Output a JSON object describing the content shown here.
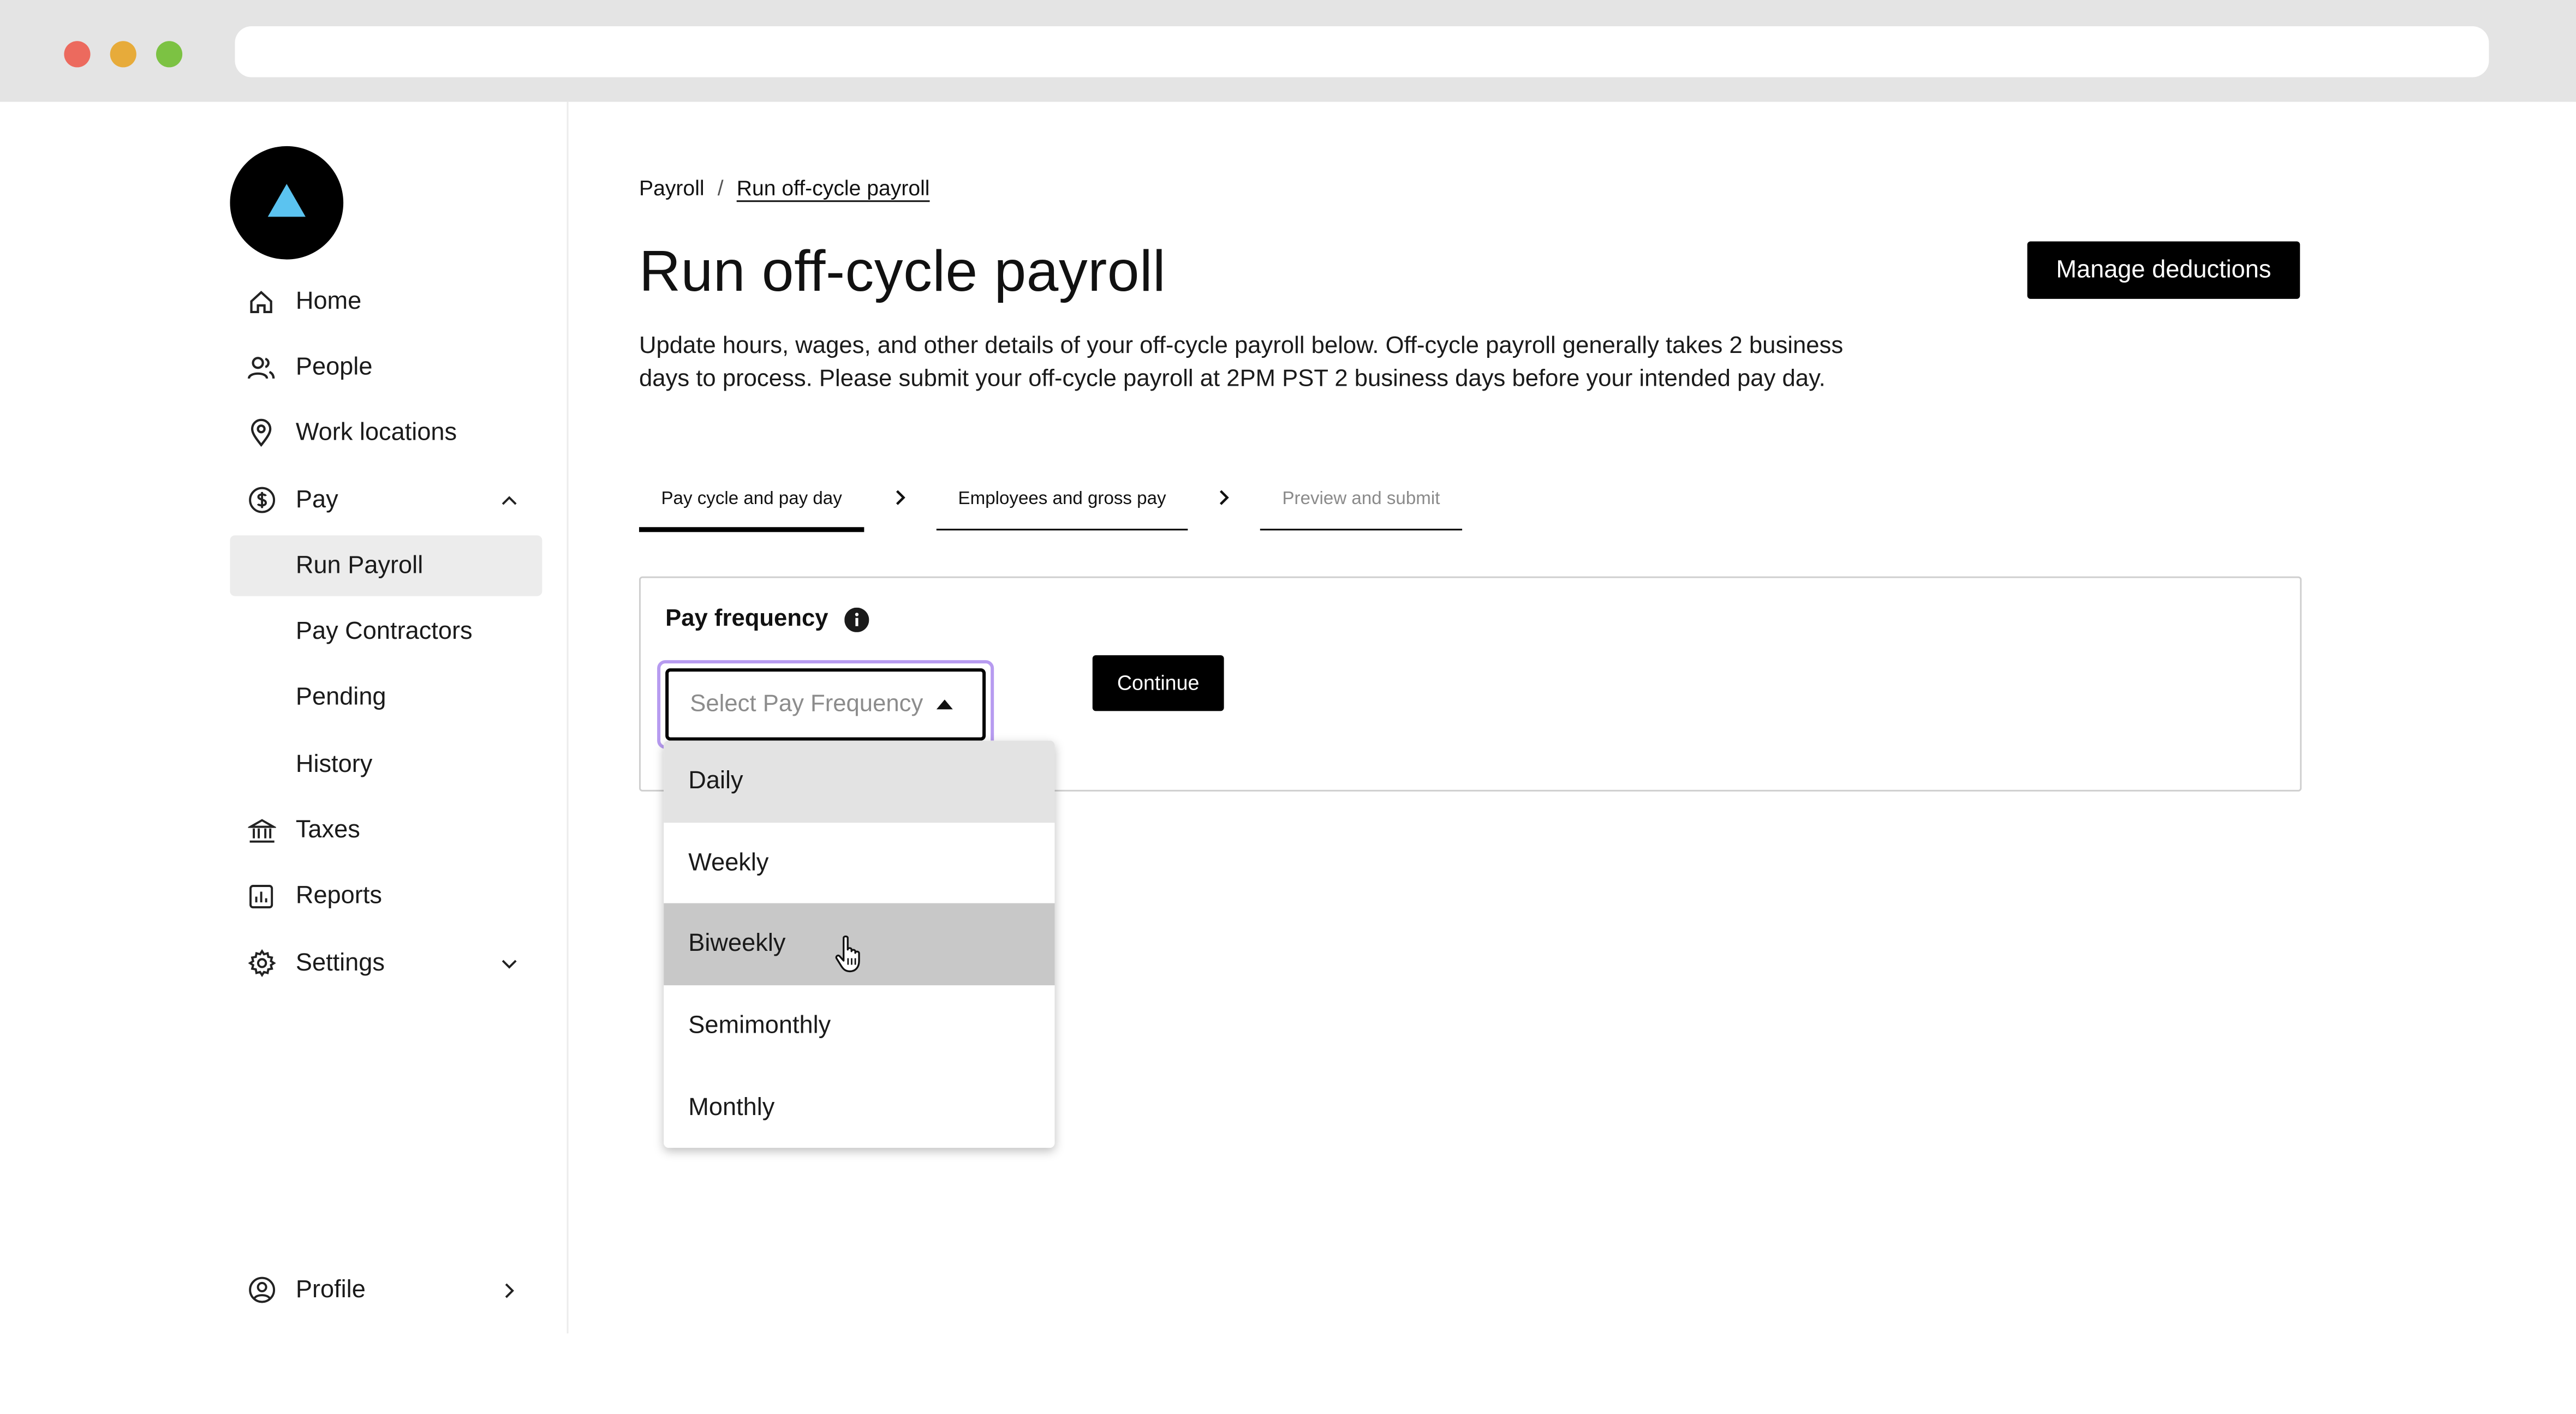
{
  "sidebar": {
    "items": [
      {
        "label": "Home",
        "icon": "home-icon"
      },
      {
        "label": "People",
        "icon": "people-icon"
      },
      {
        "label": "Work locations",
        "icon": "location-pin-icon"
      },
      {
        "label": "Pay",
        "icon": "dollar-circle-icon",
        "expanded": true
      },
      {
        "label": "Run Payroll",
        "active": true
      },
      {
        "label": "Pay Contractors"
      },
      {
        "label": "Pending"
      },
      {
        "label": "History"
      },
      {
        "label": "Taxes",
        "icon": "bank-icon"
      },
      {
        "label": "Reports",
        "icon": "reports-chart-icon"
      },
      {
        "label": "Settings",
        "icon": "gear-icon",
        "expanded": false
      }
    ],
    "profile": {
      "label": "Profile",
      "icon": "user-circle-icon"
    }
  },
  "breadcrumb": {
    "root": "Payroll",
    "separator": "/",
    "current": "Run off-cycle payroll"
  },
  "page": {
    "title": "Run off-cycle payroll",
    "description": "Update hours, wages, and other details of your off-cycle payroll below. Off-cycle payroll generally takes 2 business days to process. Please submit your off-cycle payroll at 2PM PST 2 business days before your intended pay day."
  },
  "toolbar": {
    "manage_label": "Manage deductions"
  },
  "steps": [
    {
      "label": "Pay cycle and pay day",
      "state": "active"
    },
    {
      "label": "Employees and gross pay",
      "state": "default"
    },
    {
      "label": "Preview and submit",
      "state": "disabled"
    }
  ],
  "form": {
    "label": "Pay frequency",
    "select_placeholder": "Select Pay Frequency",
    "continue_label": "Continue",
    "options": [
      "Daily",
      "Weekly",
      "Biweekly",
      "Semimonthly",
      "Monthly"
    ],
    "focused_option": "Daily",
    "hovered_option": "Biweekly"
  },
  "colors": {
    "accent": "#000000",
    "focus_ring": "#b79bf0",
    "logo_triangle": "#5bc3f0"
  }
}
